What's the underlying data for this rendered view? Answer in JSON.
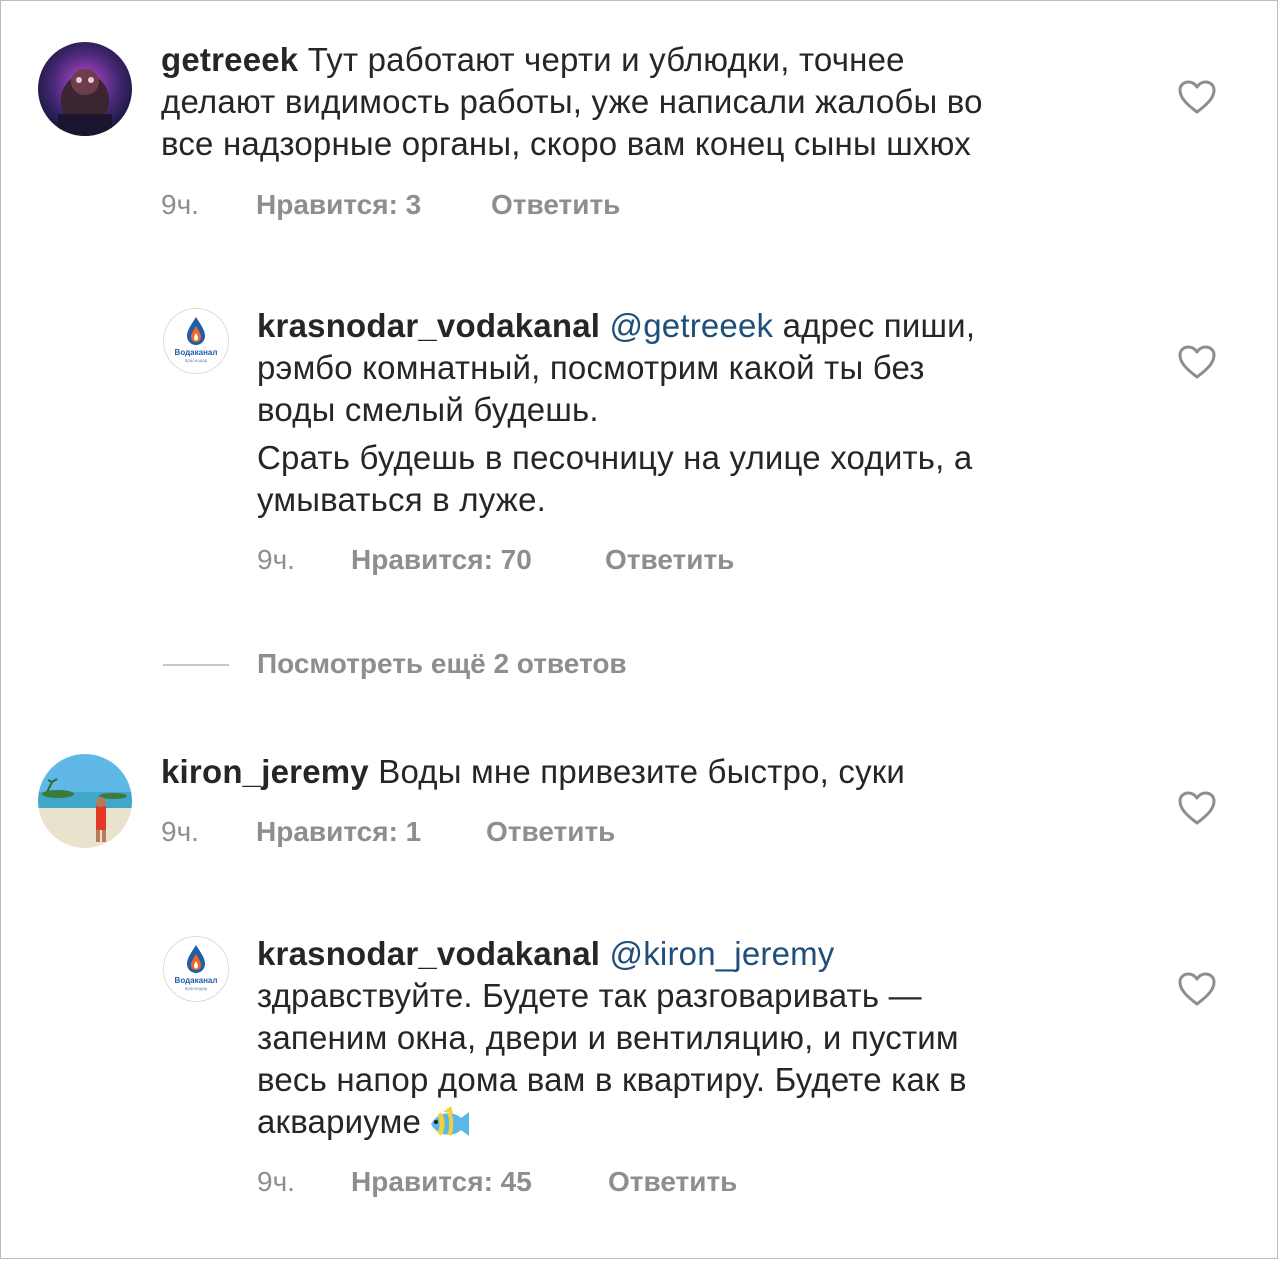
{
  "comments": [
    {
      "username": "getreeek",
      "mention": "",
      "lines": [
        "Тут работают черти и ублюдки, точнее",
        "делают видимость работы, уже написали жалобы во",
        "все надзорные органы, скоро вам конец сыны шхюх"
      ],
      "time": "9ч.",
      "likes": "Нравится: 3",
      "reply": "Ответить"
    },
    {
      "username": "krasnodar_vodakanal",
      "mention": "@getreeek",
      "lines": [
        "адрес пиши,",
        "рэмбо комнатный, посмотрим какой ты без",
        "воды смелый будешь.",
        "Срать будешь в песочницу на улице ходить, а",
        "умываться в луже."
      ],
      "time": "9ч.",
      "likes": "Нравится: 70",
      "reply": "Ответить"
    },
    {
      "username": "kiron_jeremy",
      "mention": "",
      "lines": [
        "Воды мне привезите быстро, суки"
      ],
      "time": "9ч.",
      "likes": "Нравится: 1",
      "reply": "Ответить"
    },
    {
      "username": "krasnodar_vodakanal",
      "mention": "@kiron_jeremy",
      "lines": [
        "",
        "здравствуйте. Будете так разговаривать —",
        "запеним окна, двери и вентиляцию, и пустим",
        "весь напор дома вам в квартиру. Будете как в",
        "аквариуме"
      ],
      "time": "9ч.",
      "likes": "Нравится: 45",
      "reply": "Ответить"
    }
  ],
  "view_more": "Посмотреть ещё 2 ответов",
  "logo": {
    "name": "Водаканал",
    "sub": "Краснодар"
  },
  "icons": {
    "like": "heart-outline-icon",
    "emoji": "tropical-fish-emoji"
  },
  "colors": {
    "text": "#262626",
    "muted": "#8e8e8e",
    "mention": "#1f4e7a",
    "logo_blue": "#1e5fa8",
    "logo_orange": "#f26522"
  }
}
